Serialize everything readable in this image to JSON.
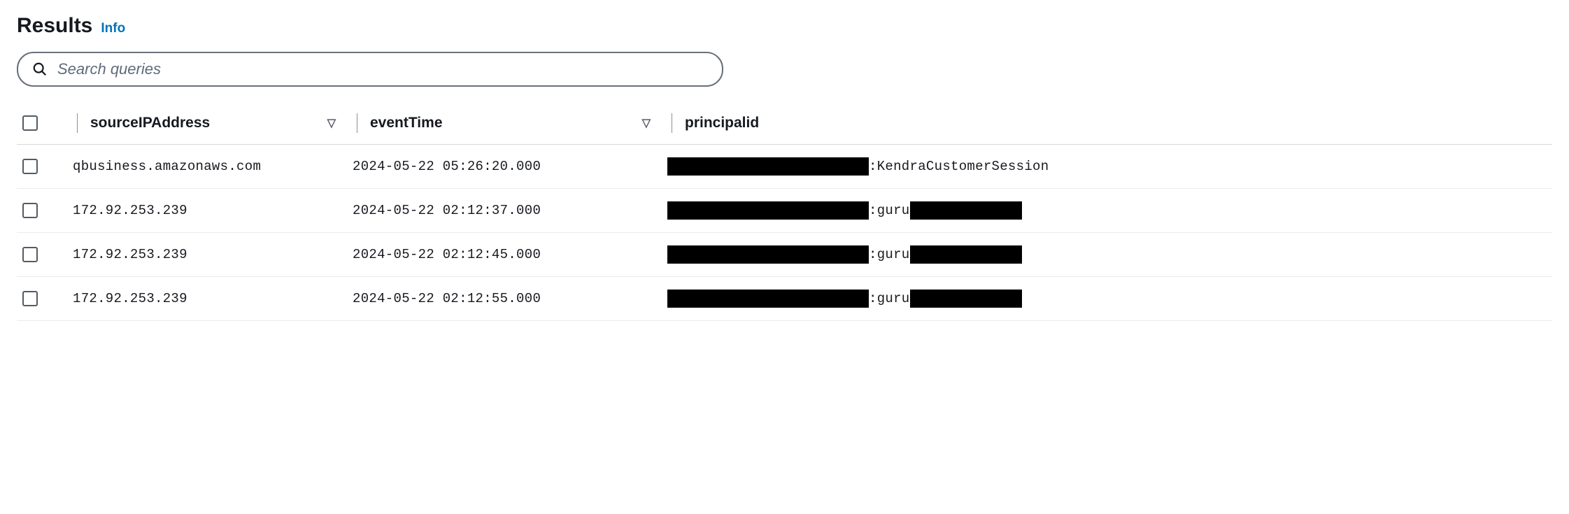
{
  "header": {
    "title": "Results",
    "info_label": "Info"
  },
  "search": {
    "placeholder": "Search queries",
    "value": ""
  },
  "table": {
    "columns": {
      "source_ip": "sourceIPAddress",
      "event_time": "eventTime",
      "principal_id": "principalid"
    },
    "rows": [
      {
        "source_ip": "qbusiness.amazonaws.com",
        "event_time": "2024-05-22 05:26:20.000",
        "principal_sep": ":",
        "principal_suffix": "KendraCustomerSession",
        "trailing_redact": false
      },
      {
        "source_ip": "172.92.253.239",
        "event_time": "2024-05-22 02:12:37.000",
        "principal_sep": ":",
        "principal_suffix": "guru",
        "trailing_redact": true
      },
      {
        "source_ip": "172.92.253.239",
        "event_time": "2024-05-22 02:12:45.000",
        "principal_sep": ":",
        "principal_suffix": "guru",
        "trailing_redact": true
      },
      {
        "source_ip": "172.92.253.239",
        "event_time": "2024-05-22 02:12:55.000",
        "principal_sep": ":",
        "principal_suffix": "guru",
        "trailing_redact": true
      }
    ]
  }
}
